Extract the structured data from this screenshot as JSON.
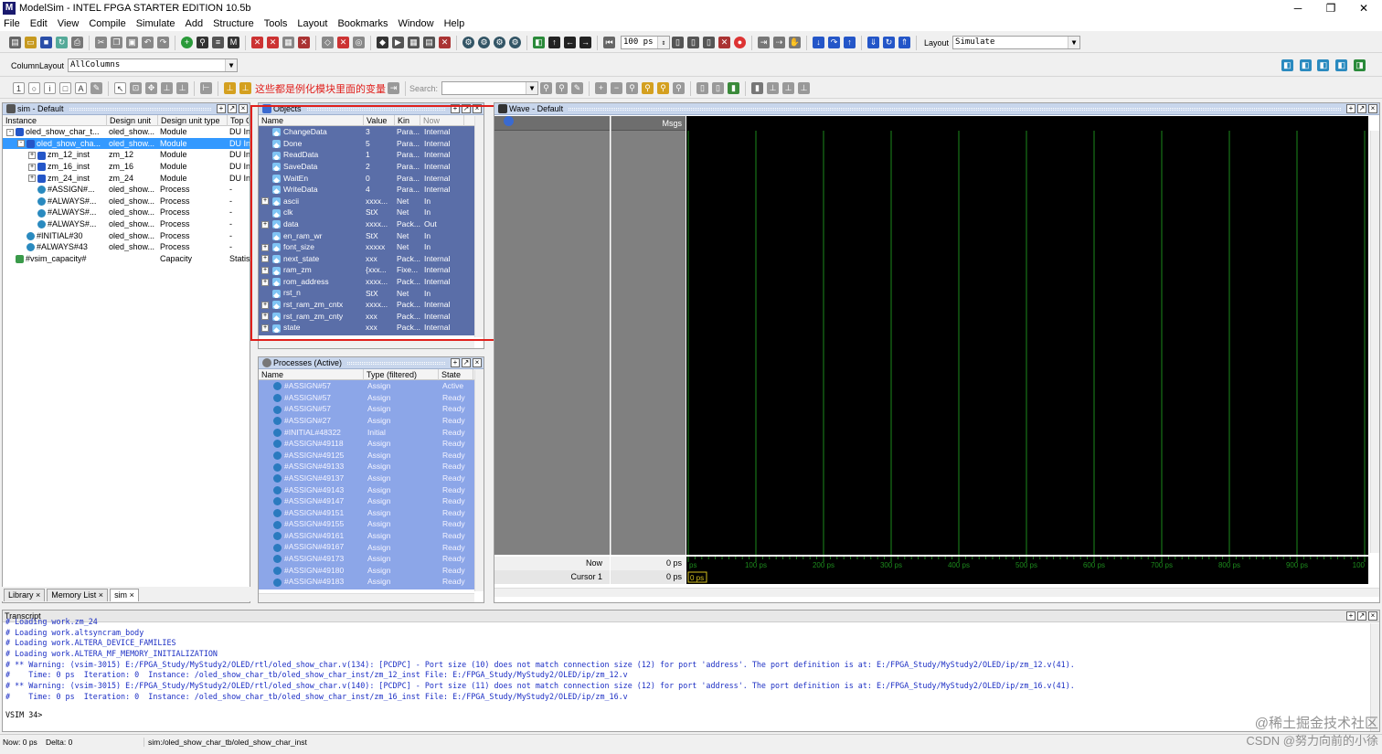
{
  "window": {
    "title": "ModelSim - INTEL FPGA STARTER EDITION 10.5b",
    "controls": [
      "─",
      "❐",
      "✕"
    ]
  },
  "menu": [
    "File",
    "Edit",
    "View",
    "Compile",
    "Simulate",
    "Add",
    "Structure",
    "Tools",
    "Layout",
    "Bookmarks",
    "Window",
    "Help"
  ],
  "toolbar": {
    "run_length": "100 ps",
    "layout_label": "Layout",
    "layout_value": "Simulate"
  },
  "column_layout": {
    "label": "ColumnLayout",
    "value": "AllColumns"
  },
  "annotation": "这些都是例化模块里面的变量",
  "search": {
    "label": "Search:",
    "value": ""
  },
  "sim_panel": {
    "title": "sim - Default",
    "columns": [
      "Instance",
      "Design unit",
      "Design unit type",
      "Top C"
    ],
    "rows": [
      {
        "indent": 0,
        "exp": "-",
        "name": "oled_show_char_t...",
        "unit": "oled_show...",
        "type": "Module",
        "top": "DU In",
        "selected": false
      },
      {
        "indent": 1,
        "exp": "-",
        "name": "oled_show_cha...",
        "unit": "oled_show...",
        "type": "Module",
        "top": "DU In",
        "selected": true
      },
      {
        "indent": 2,
        "exp": "+",
        "name": "zm_12_inst",
        "unit": "zm_12",
        "type": "Module",
        "top": "DU In",
        "selected": false
      },
      {
        "indent": 2,
        "exp": "+",
        "name": "zm_16_inst",
        "unit": "zm_16",
        "type": "Module",
        "top": "DU In",
        "selected": false
      },
      {
        "indent": 2,
        "exp": "+",
        "name": "zm_24_inst",
        "unit": "zm_24",
        "type": "Module",
        "top": "DU In",
        "selected": false
      },
      {
        "indent": 2,
        "exp": "",
        "name": "#ASSIGN#...",
        "unit": "oled_show...",
        "type": "Process",
        "top": "-",
        "selected": false
      },
      {
        "indent": 2,
        "exp": "",
        "name": "#ALWAYS#...",
        "unit": "oled_show...",
        "type": "Process",
        "top": "-",
        "selected": false
      },
      {
        "indent": 2,
        "exp": "",
        "name": "#ALWAYS#...",
        "unit": "oled_show...",
        "type": "Process",
        "top": "-",
        "selected": false
      },
      {
        "indent": 2,
        "exp": "",
        "name": "#ALWAYS#...",
        "unit": "oled_show...",
        "type": "Process",
        "top": "-",
        "selected": false
      },
      {
        "indent": 1,
        "exp": "",
        "name": "#INITIAL#30",
        "unit": "oled_show...",
        "type": "Process",
        "top": "-",
        "selected": false
      },
      {
        "indent": 1,
        "exp": "",
        "name": "#ALWAYS#43",
        "unit": "oled_show...",
        "type": "Process",
        "top": "-",
        "selected": false
      },
      {
        "indent": 0,
        "exp": "",
        "name": "#vsim_capacity#",
        "unit": "",
        "type": "Capacity",
        "top": "Statis",
        "selected": false
      }
    ],
    "tabs": [
      "Library",
      "Memory List",
      "sim"
    ]
  },
  "objects_panel": {
    "title": "Objects",
    "columns": [
      "Name",
      "Value",
      "Kin",
      "Now"
    ],
    "rows": [
      {
        "exp": "",
        "name": "ChangeData",
        "value": "3",
        "kind": "Para...",
        "mode": "Internal"
      },
      {
        "exp": "",
        "name": "Done",
        "value": "5",
        "kind": "Para...",
        "mode": "Internal"
      },
      {
        "exp": "",
        "name": "ReadData",
        "value": "1",
        "kind": "Para...",
        "mode": "Internal"
      },
      {
        "exp": "",
        "name": "SaveData",
        "value": "2",
        "kind": "Para...",
        "mode": "Internal"
      },
      {
        "exp": "",
        "name": "WaitEn",
        "value": "0",
        "kind": "Para...",
        "mode": "Internal"
      },
      {
        "exp": "",
        "name": "WriteData",
        "value": "4",
        "kind": "Para...",
        "mode": "Internal"
      },
      {
        "exp": "+",
        "name": "ascii",
        "value": "xxxx...",
        "kind": "Net",
        "mode": "In"
      },
      {
        "exp": "",
        "name": "clk",
        "value": "StX",
        "kind": "Net",
        "mode": "In"
      },
      {
        "exp": "+",
        "name": "data",
        "value": "xxxx...",
        "kind": "Pack...",
        "mode": "Out"
      },
      {
        "exp": "",
        "name": "en_ram_wr",
        "value": "StX",
        "kind": "Net",
        "mode": "In"
      },
      {
        "exp": "+",
        "name": "font_size",
        "value": "xxxxx",
        "kind": "Net",
        "mode": "In"
      },
      {
        "exp": "+",
        "name": "next_state",
        "value": "xxx",
        "kind": "Pack...",
        "mode": "Internal"
      },
      {
        "exp": "+",
        "name": "ram_zm",
        "value": "{xxx...",
        "kind": "Fixe...",
        "mode": "Internal"
      },
      {
        "exp": "+",
        "name": "rom_address",
        "value": "xxxx...",
        "kind": "Pack...",
        "mode": "Internal"
      },
      {
        "exp": "",
        "name": "rst_n",
        "value": "StX",
        "kind": "Net",
        "mode": "In"
      },
      {
        "exp": "+",
        "name": "rst_ram_zm_cntx",
        "value": "xxxx...",
        "kind": "Pack...",
        "mode": "Internal"
      },
      {
        "exp": "+",
        "name": "rst_ram_zm_cnty",
        "value": "xxx",
        "kind": "Pack...",
        "mode": "Internal"
      },
      {
        "exp": "+",
        "name": "state",
        "value": "xxx",
        "kind": "Pack...",
        "mode": "Internal"
      }
    ]
  },
  "processes_panel": {
    "title": "Processes (Active)",
    "columns": [
      "Name",
      "Type (filtered)",
      "State"
    ],
    "rows": [
      {
        "name": "#ASSIGN#57",
        "type": "Assign",
        "state": "Active"
      },
      {
        "name": "#ASSIGN#57",
        "type": "Assign",
        "state": "Ready"
      },
      {
        "name": "#ASSIGN#57",
        "type": "Assign",
        "state": "Ready"
      },
      {
        "name": "#ASSIGN#27",
        "type": "Assign",
        "state": "Ready"
      },
      {
        "name": "#INITIAL#48322",
        "type": "Initial",
        "state": "Ready"
      },
      {
        "name": "#ASSIGN#49118",
        "type": "Assign",
        "state": "Ready"
      },
      {
        "name": "#ASSIGN#49125",
        "type": "Assign",
        "state": "Ready"
      },
      {
        "name": "#ASSIGN#49133",
        "type": "Assign",
        "state": "Ready"
      },
      {
        "name": "#ASSIGN#49137",
        "type": "Assign",
        "state": "Ready"
      },
      {
        "name": "#ASSIGN#49143",
        "type": "Assign",
        "state": "Ready"
      },
      {
        "name": "#ASSIGN#49147",
        "type": "Assign",
        "state": "Ready"
      },
      {
        "name": "#ASSIGN#49151",
        "type": "Assign",
        "state": "Ready"
      },
      {
        "name": "#ASSIGN#49155",
        "type": "Assign",
        "state": "Ready"
      },
      {
        "name": "#ASSIGN#49161",
        "type": "Assign",
        "state": "Ready"
      },
      {
        "name": "#ASSIGN#49167",
        "type": "Assign",
        "state": "Ready"
      },
      {
        "name": "#ASSIGN#49173",
        "type": "Assign",
        "state": "Ready"
      },
      {
        "name": "#ASSIGN#49180",
        "type": "Assign",
        "state": "Ready"
      },
      {
        "name": "#ASSIGN#49183",
        "type": "Assign",
        "state": "Ready"
      }
    ]
  },
  "wave_panel": {
    "title": "Wave - Default",
    "msgs_label": "Msgs",
    "now_label": "Now",
    "now_value": "0 ps",
    "cursor_label": "Cursor 1",
    "cursor_value": "0 ps",
    "cursor_marker": "0 ps",
    "time_ticks": [
      "ps",
      "100 ps",
      "200 ps",
      "300 ps",
      "400 ps",
      "500 ps",
      "600 ps",
      "700 ps",
      "800 ps",
      "900 ps",
      "100"
    ]
  },
  "transcript": {
    "title": "Transcript",
    "lines": [
      "# Loading work.zm_24",
      "# Loading work.altsyncram_body",
      "# Loading work.ALTERA_DEVICE_FAMILIES",
      "# Loading work.ALTERA_MF_MEMORY_INITIALIZATION",
      "# ** Warning: (vsim-3015) E:/FPGA_Study/MyStudy2/OLED/rtl/oled_show_char.v(134): [PCDPC] - Port size (10) does not match connection size (12) for port 'address'. The port definition is at: E:/FPGA_Study/MyStudy2/OLED/ip/zm_12.v(41).",
      "#    Time: 0 ps  Iteration: 0  Instance: /oled_show_char_tb/oled_show_char_inst/zm_12_inst File: E:/FPGA_Study/MyStudy2/OLED/ip/zm_12.v",
      "# ** Warning: (vsim-3015) E:/FPGA_Study/MyStudy2/OLED/rtl/oled_show_char.v(140): [PCDPC] - Port size (11) does not match connection size (12) for port 'address'. The port definition is at: E:/FPGA_Study/MyStudy2/OLED/ip/zm_16.v(41).",
      "#    Time: 0 ps  Iteration: 0  Instance: /oled_show_char_tb/oled_show_char_inst/zm_16_inst File: E:/FPGA_Study/MyStudy2/OLED/ip/zm_16.v"
    ],
    "prompt": "VSIM 34>"
  },
  "statusbar": {
    "now": "Now: 0 ps",
    "delta": "Delta: 0",
    "path": "sim:/oled_show_char_tb/oled_show_char_inst"
  },
  "watermark": {
    "line1": "@稀土掘金技术社区",
    "line2": "CSDN @努力向前的小徐"
  },
  "colors": {
    "accent": "#3399ff",
    "objects_bg": "#5a6ea8",
    "processes_bg": "#8ca6e8",
    "annotation": "#e0201c",
    "wave_bg": "#000000",
    "wave_grid": "#1d8a1d",
    "transcript_text": "#1c2fc4"
  }
}
